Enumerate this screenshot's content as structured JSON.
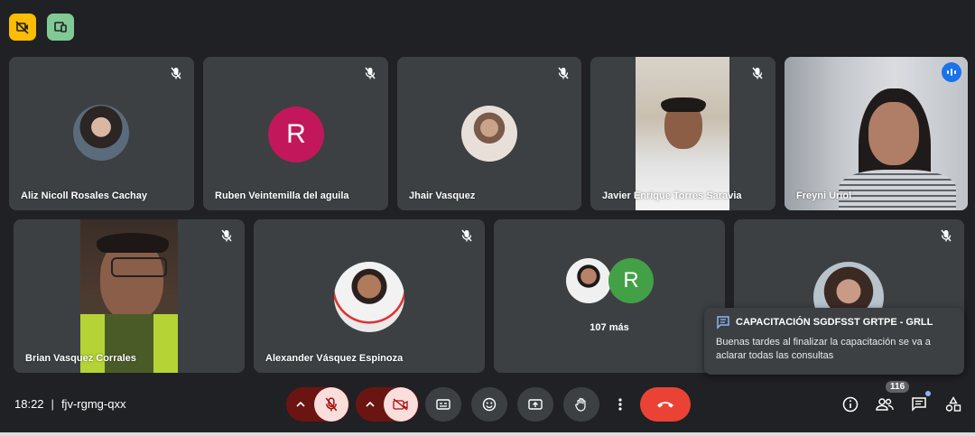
{
  "top_icons": [
    {
      "icon": "no-record-icon",
      "color": "#fbbc04"
    },
    {
      "icon": "devices-icon",
      "color": "#81c995"
    }
  ],
  "participants_row1": [
    {
      "name": "Aliz Nicoll Rosales Cachay",
      "type": "photo"
    },
    {
      "name": "Ruben Veintemilla del aguila",
      "type": "letter",
      "letter": "R",
      "color": "#c2185b"
    },
    {
      "name": "Jhair Vasquez",
      "type": "photo"
    },
    {
      "name": "Javier Enrique Torres Saravia",
      "type": "video"
    },
    {
      "name": "Freyni Uriol",
      "type": "video",
      "speaking": true
    }
  ],
  "participants_row2": [
    {
      "name": "Brian Vasquez Corrales",
      "type": "video"
    },
    {
      "name": "Alexander Vásquez Espinoza",
      "type": "photo"
    },
    {
      "more_label": "107 más",
      "letter": "R",
      "color": "#43a047"
    },
    {
      "name": "",
      "type": "photo"
    }
  ],
  "chat_notification": {
    "title": "CAPACITACIÓN SGDFSST GRTPE - GRLL",
    "message": "Buenas tardes al finalizar la capacitación se va a aclarar todas las consultas"
  },
  "meeting": {
    "time": "18:22",
    "separator": "|",
    "code": "fjv-rgmg-qxx"
  },
  "participants_count": "116",
  "colors": {
    "background": "#202124",
    "tile": "#3c4043",
    "accent": "#8ab4f8",
    "hangup": "#ea4335",
    "muted_bg": "#f9dedc",
    "muted_pill": "#6b1512"
  }
}
